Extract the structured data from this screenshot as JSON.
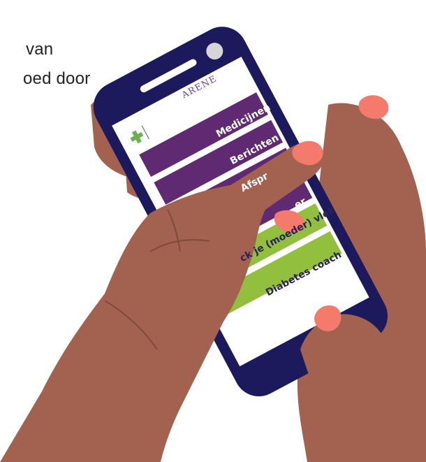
{
  "background_text": {
    "line1": "van",
    "line2": "oed door"
  },
  "app": {
    "logo_text": "ARENE",
    "menu": [
      {
        "label": "Medicijnen",
        "style": "purple"
      },
      {
        "label": "Berichten",
        "style": "purple"
      },
      {
        "label": "Afspr",
        "style": "purple"
      },
      {
        "label": "er",
        "style": "purple"
      },
      {
        "label": "ck je (moeder) vlek",
        "style": "green"
      },
      {
        "label": "Diabetes coach",
        "style": "green"
      }
    ]
  },
  "colors": {
    "phone_frame": "#1c1a5c",
    "menu_purple": "#5f2a72",
    "menu_green": "#93bf3e",
    "skin": "#a3624f",
    "skin_dark": "#7e4a3a",
    "nails": "#f47a6b",
    "screen": "#ffffff"
  }
}
